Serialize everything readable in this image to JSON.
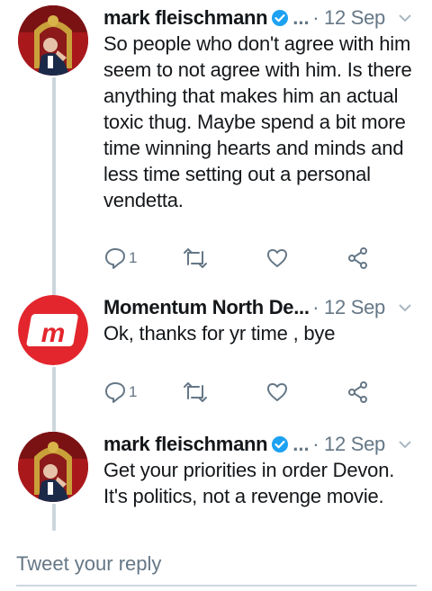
{
  "tweets": [
    {
      "author": "mark fleischmann",
      "truncation": "...",
      "date": "· 12 Sep",
      "text": "So people who don't agree with him seem to not agree with him. Is there anything that makes him an actual toxic thug. Maybe spend a bit more time winning hearts and minds and less time setting out a personal vendetta.",
      "reply_count": "1",
      "verified": true
    },
    {
      "author": "Momentum North De...",
      "date": "· 12 Sep",
      "text": "Ok, thanks for yr time , bye",
      "reply_count": "1",
      "verified": false,
      "avatar_letters": "m"
    },
    {
      "author": "mark fleischmann",
      "truncation": "...",
      "date": "· 12 Sep",
      "text": "Get your priorities in order Devon. It's politics, not a revenge movie.",
      "verified": true
    }
  ],
  "reply_box": {
    "placeholder": "Tweet your reply"
  },
  "colors": {
    "verified_blue": "#1da1f2",
    "secondary_text": "#657786",
    "thread_line": "#ccd6dd",
    "momentum_red": "#e3262d"
  }
}
